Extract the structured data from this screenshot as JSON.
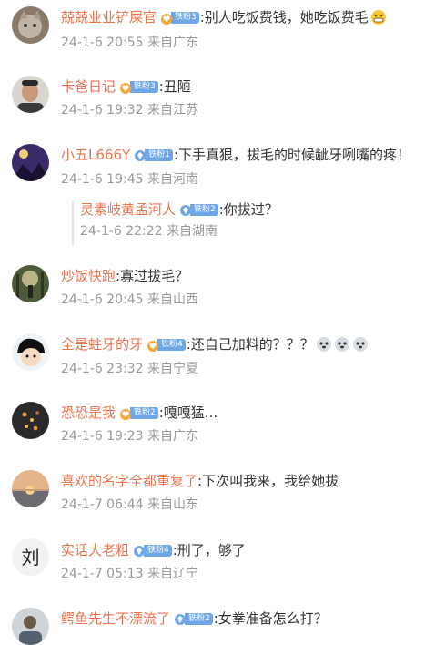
{
  "comments": [
    {
      "name": "兢兢业业铲屎官",
      "badge": "铁粉3",
      "text": ":别人吃饭费钱，她吃饭费毛",
      "emoji": "grin-emoji",
      "time": "24-1-6 20:55 来自广东",
      "avatar": "cat-avatar"
    },
    {
      "name": "卡爸日记",
      "badge": "铁粉3",
      "text": ":丑陋",
      "time": "24-1-6 19:32 来自江苏",
      "avatar": "man-avatar"
    },
    {
      "name": "小五L666Y",
      "badge": "铁粉1",
      "text": ":下手真狠，拔毛的时候龇牙咧嘴的疼！",
      "time": "24-1-6 19:45 来自河南",
      "avatar": "night-avatar",
      "reply": {
        "name": "灵素岐黄孟河人",
        "badge": "铁粉2",
        "text": ":你拔过？",
        "time": "24-1-6 22:22 来自湖南"
      }
    },
    {
      "name": "炒饭快跑",
      "badge": "",
      "text": ":寡过拔毛？",
      "time": "24-1-6 20:45 来自山西",
      "avatar": "forest-avatar"
    },
    {
      "name": "全是蛀牙的牙",
      "badge": "铁粉4",
      "text": ":还自己加料的？？？",
      "emoji": "dog-emoji",
      "time": "24-1-6 23:32 来自宁夏",
      "avatar": "anime-avatar"
    },
    {
      "name": "恐恐是我",
      "badge": "铁粉2",
      "text": ":嘎嘎猛...",
      "time": "24-1-6 19:23 来自广东",
      "avatar": "dots-avatar"
    },
    {
      "name": "喜欢的名字全都重复了",
      "badge": "",
      "text": ":下次叫我来，我给她拔",
      "time": "24-1-7 06:44 来自山东",
      "avatar": "sunset-avatar"
    },
    {
      "name": "实话大老粗",
      "badge": "铁粉4",
      "text": ":刑了，够了",
      "time": "24-1-7 05:13 来自辽宁",
      "avatar": "calligraphy-avatar",
      "avatar_char": "刘"
    },
    {
      "name": "鳄鱼先生不漂流了",
      "badge": "铁粉2",
      "text": ":女拳准备怎么打？",
      "time": "",
      "avatar": "person-avatar"
    }
  ],
  "colors": {
    "username": "#eb7350",
    "text": "#333333",
    "meta": "#999999",
    "badge": "#6fa7e6"
  }
}
